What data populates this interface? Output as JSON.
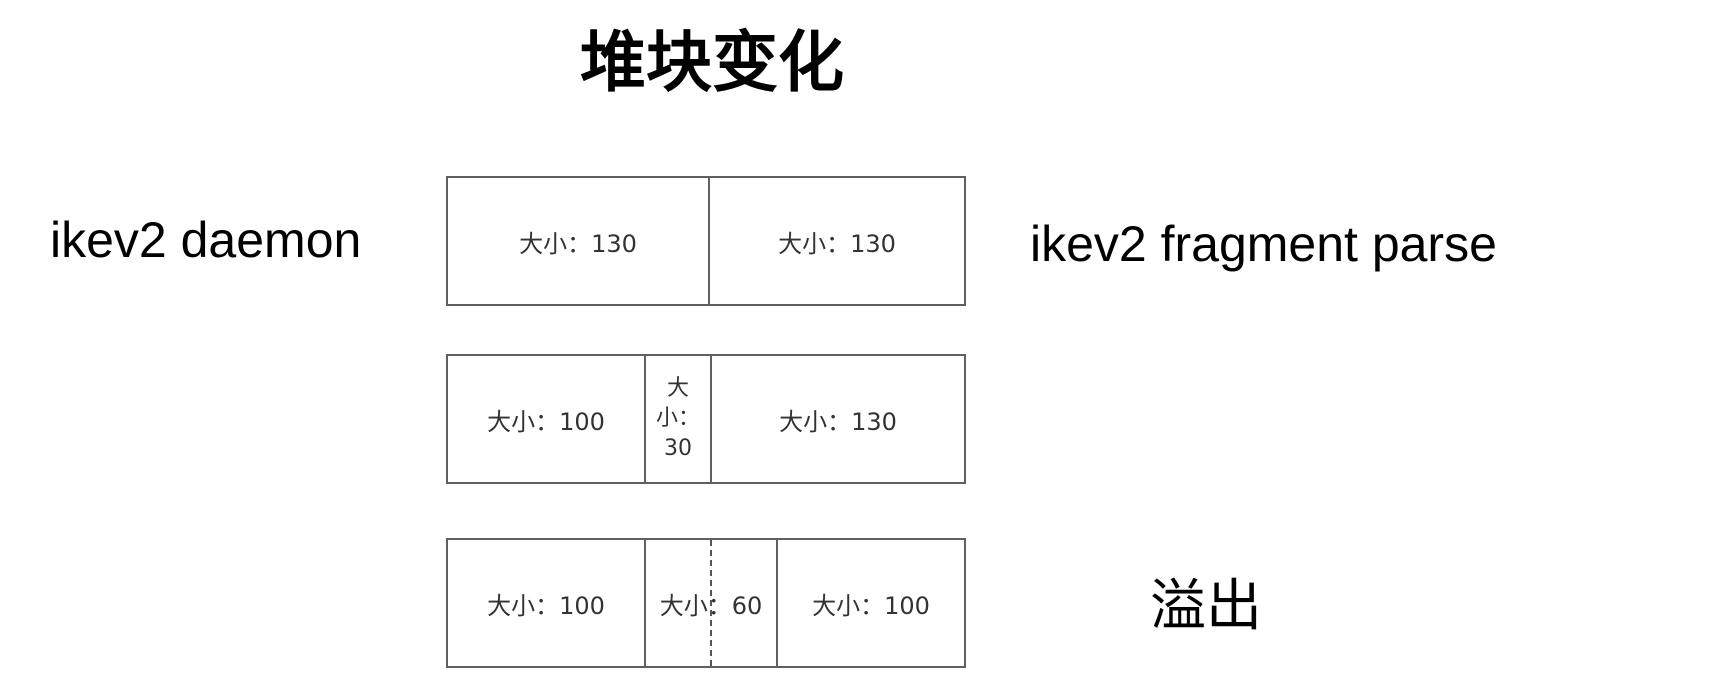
{
  "title": "堆块变化",
  "labels": {
    "left": "ikev2 daemon",
    "right": "ikev2 fragment parse",
    "overflow": "溢出"
  },
  "rows": [
    {
      "chunks": [
        "大小：130",
        "大小：130"
      ]
    },
    {
      "chunks": [
        "大小：100",
        "大\n小：\n30",
        "大小：130"
      ]
    },
    {
      "chunks": [
        "大小：100",
        "大小：60",
        "大小：100"
      ],
      "dashed_divider_in_middle_chunk": true
    }
  ],
  "colors": {
    "border": "#606060",
    "chunk_text": "#333333",
    "label_text": "#000000",
    "background": "#ffffff"
  }
}
